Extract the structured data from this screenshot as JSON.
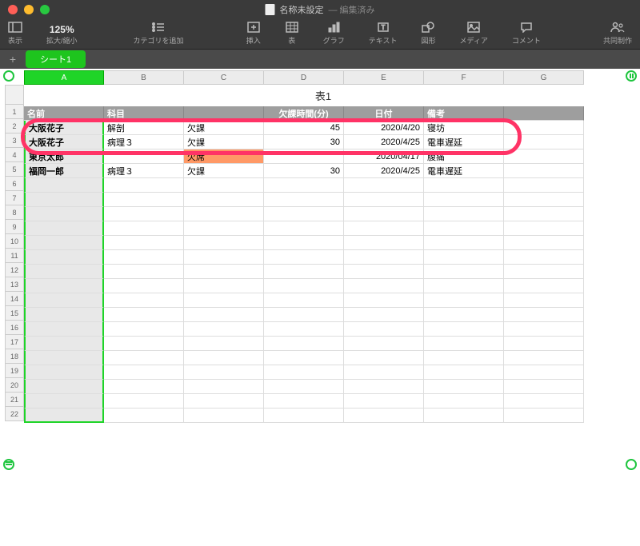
{
  "window": {
    "title": "名称未設定",
    "status": "— 編集済み"
  },
  "toolbar": {
    "view": "表示",
    "zoom": "125%",
    "zoom_label": "拡大/縮小",
    "category": "カテゴリを追加",
    "insert": "挿入",
    "table": "表",
    "chart": "グラフ",
    "text": "テキスト",
    "shape": "図形",
    "media": "メディア",
    "comment": "コメント",
    "collab": "共同制作"
  },
  "tabs": {
    "sheet1": "シート1"
  },
  "table": {
    "title": "表1",
    "columns": [
      "A",
      "B",
      "C",
      "D",
      "E",
      "F",
      "G"
    ],
    "headers": {
      "name": "名前",
      "subject": "科目",
      "absent": "欠課時間(分)",
      "date": "日付",
      "note": "備考"
    },
    "rows": [
      {
        "name": "大阪花子",
        "subject": "解剖",
        "status": "欠課",
        "minutes": "45",
        "date": "2020/4/20",
        "note": "寝坊"
      },
      {
        "name": "大阪花子",
        "subject": "病理３",
        "status": "欠課",
        "minutes": "30",
        "date": "2020/4/25",
        "note": "電車遅延"
      },
      {
        "name": "東京太郎",
        "subject": "",
        "status": "欠席",
        "minutes": "",
        "date": "2020/04/17",
        "note": "腹痛"
      },
      {
        "name": "福岡一郎",
        "subject": "病理３",
        "status": "欠課",
        "minutes": "30",
        "date": "2020/4/25",
        "note": "電車遅延"
      }
    ],
    "row_numbers": [
      "1",
      "2",
      "3",
      "4",
      "5",
      "6",
      "7",
      "8",
      "9",
      "10",
      "11",
      "12",
      "13",
      "14",
      "15",
      "16",
      "17",
      "18",
      "19",
      "20",
      "21",
      "22"
    ]
  }
}
